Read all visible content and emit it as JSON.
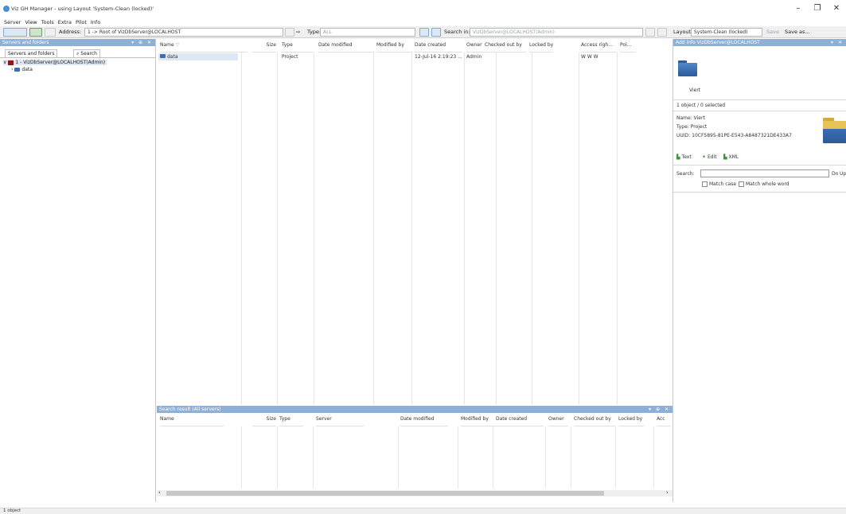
{
  "window": {
    "title": "Viz GH Manager - using Layout 'System-Clean (locked)'",
    "minimize": "–",
    "maximize": "❐",
    "close": "✕"
  },
  "menu": [
    "Server",
    "View",
    "Tools",
    "Extra",
    "Pilot",
    "Info"
  ],
  "toolbar": {
    "address_label": "Address:",
    "address_value": "1 -> Root of VizDbServer@LOCALHOST",
    "type_label": "Type:",
    "type_value": "ALL",
    "search_in_label": "Search in:",
    "search_in_value": "VizDbServer@LOCALHOST(Admin)",
    "layout_label": "Layout:",
    "layout_value": "System-Clean (locked)",
    "save_label": "Save",
    "save_as_label": "Save as..."
  },
  "left_panel": {
    "header": "Servers and folders",
    "controls": "▾ ⊕ ✕",
    "tabs": [
      "Servers and folders",
      "Search"
    ],
    "tree": {
      "server": "1 - VizDbServer@LOCALHOST(Admin)",
      "folder": "data"
    }
  },
  "main_list": {
    "columns": [
      "Name",
      "Size",
      "Type",
      "Date modified",
      "Modified by",
      "Date created",
      "Owner",
      "Checked out by",
      "Locked by",
      "Access righ...",
      "Pol..."
    ],
    "rows": [
      {
        "name": "data",
        "size": "",
        "type": "Project",
        "date_modified": "",
        "modified_by": "",
        "date_created": "12-Jul-16 2:19:23 ...",
        "owner": "Admin",
        "checked_out_by": "",
        "locked_by": "",
        "access": "W W W",
        "pol": ""
      }
    ]
  },
  "search_panel": {
    "header": "Search result (All servers)",
    "controls": "▾ ⊕ ✕",
    "columns": [
      "Name",
      "Size",
      "Type",
      "Server",
      "Date modified",
      "Modified by",
      "Date created",
      "Owner",
      "Checked out by",
      "Locked by",
      "Acc"
    ]
  },
  "right_panel": {
    "header": "Add info  VizDbServer@LOCALHOST",
    "controls": "▾ ✕",
    "item_label": "Viert",
    "selection_status": "1 object / 0 selected",
    "name_label": "Name:",
    "name_value": "Viert",
    "type_label": "Type:",
    "type_value": "Project",
    "uuid_label": "UUID:",
    "uuid_value": "10CF5895-81PE-E543-A8487321DE433A7",
    "tabs": [
      "Text",
      "Edit",
      "XML"
    ],
    "search_label": "Search:",
    "search_btn": "Dn",
    "search_btn2": "Up",
    "match_case": "Match case",
    "match_whole_word": "Match whole word"
  },
  "status_bar": {
    "text": "1 object"
  },
  "colors": {
    "panel_header": "#8fb0d6",
    "folder_blue": "#3d6fb0",
    "server_red": "#8b1a1a"
  }
}
